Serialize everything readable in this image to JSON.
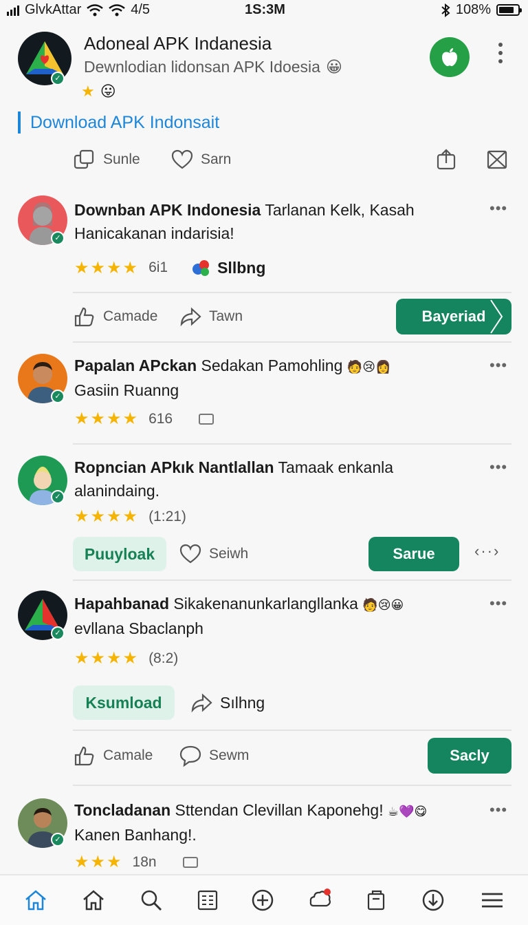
{
  "status": {
    "carrier": "GlvkAttar",
    "extra": "4/5",
    "time": "1S:3M",
    "battery": "108%"
  },
  "app": {
    "title": "Adoneal APK Indanesia",
    "subtitle": "Dewnlodian lidonsan APK Idoesia",
    "download_link": "Download APK Indonsait"
  },
  "actions": {
    "share": "Sunle",
    "save": "Sarn"
  },
  "posts": [
    {
      "author": "Downban APK Indonesia",
      "text_rest": "Tarlanan Kelk, Kasah",
      "line2": "Hanicakanan indarisia!",
      "rating": "6i1",
      "badge": "Sllbng",
      "act1": "Camade",
      "act2": "Tawn",
      "button": "Bayeriad"
    },
    {
      "author": "Papalan APckan",
      "text_rest": "Sedakan Pamohling",
      "line2": "Gasiin Ruanng",
      "rating": "616"
    },
    {
      "author": "Ropncian APkık Nantlallan",
      "text_rest": "Tamaak enkanla",
      "line2": "alanindaing.",
      "rating": "(1:21)",
      "soft_button": "Puuyloak",
      "act": "Seiwh",
      "button": "Sarue"
    },
    {
      "author": "Hapahbanad",
      "text_rest": "Sikakenanunkarlangllanka",
      "line2": "evllana Sbaclanph",
      "rating": "(8:2)",
      "soft_button": "Ksumload",
      "act": "Sılhng",
      "act1": "Camale",
      "act2": "Sewm",
      "button": "Sacly"
    },
    {
      "author": "Toncladanan",
      "text_rest": "Sttendan Clevillan Kaponehg!",
      "line2": "Kanen Banhang!.",
      "rating": "18n"
    }
  ],
  "colors": {
    "accent_blue": "#1d86d9",
    "brand_green": "#158560",
    "star": "#f4b400"
  }
}
